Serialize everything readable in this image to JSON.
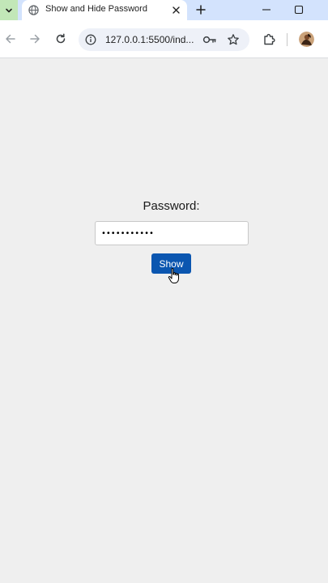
{
  "browser": {
    "tab": {
      "title": "Show and Hide Password",
      "favicon": "globe-icon"
    },
    "address_bar": {
      "url": "127.0.0.1:5500/ind..."
    },
    "icons": {
      "tab_search": "chevron-down-icon",
      "close_tab": "close-icon",
      "new_tab": "plus-icon",
      "minimize": "minimize-icon",
      "maximize": "maximize-icon",
      "back": "arrow-left-icon",
      "forward": "arrow-right-icon",
      "reload": "reload-icon",
      "site_info": "info-icon",
      "password_manager": "key-icon",
      "bookmark": "star-icon",
      "extensions": "puzzle-icon",
      "profile": "avatar"
    },
    "colors": {
      "tab_strip": "#d3e3fd",
      "tab_search_bg": "#c2e7b8",
      "omnibox_bg": "#eef1f8"
    }
  },
  "page": {
    "password_label": "Password:",
    "password_value": "•••••••••••",
    "show_button_label": "Show",
    "colors": {
      "background": "#efefef",
      "button": "#0b56b0"
    }
  }
}
